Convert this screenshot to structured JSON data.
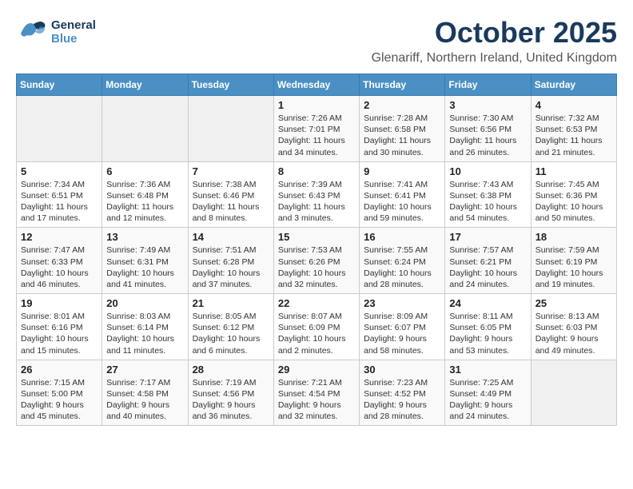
{
  "header": {
    "logo_general": "General",
    "logo_blue": "Blue",
    "month_title": "October 2025",
    "location": "Glenariff, Northern Ireland, United Kingdom"
  },
  "weekdays": [
    "Sunday",
    "Monday",
    "Tuesday",
    "Wednesday",
    "Thursday",
    "Friday",
    "Saturday"
  ],
  "weeks": [
    [
      {
        "day": "",
        "content": ""
      },
      {
        "day": "",
        "content": ""
      },
      {
        "day": "",
        "content": ""
      },
      {
        "day": "1",
        "content": "Sunrise: 7:26 AM\nSunset: 7:01 PM\nDaylight: 11 hours\nand 34 minutes."
      },
      {
        "day": "2",
        "content": "Sunrise: 7:28 AM\nSunset: 6:58 PM\nDaylight: 11 hours\nand 30 minutes."
      },
      {
        "day": "3",
        "content": "Sunrise: 7:30 AM\nSunset: 6:56 PM\nDaylight: 11 hours\nand 26 minutes."
      },
      {
        "day": "4",
        "content": "Sunrise: 7:32 AM\nSunset: 6:53 PM\nDaylight: 11 hours\nand 21 minutes."
      }
    ],
    [
      {
        "day": "5",
        "content": "Sunrise: 7:34 AM\nSunset: 6:51 PM\nDaylight: 11 hours\nand 17 minutes."
      },
      {
        "day": "6",
        "content": "Sunrise: 7:36 AM\nSunset: 6:48 PM\nDaylight: 11 hours\nand 12 minutes."
      },
      {
        "day": "7",
        "content": "Sunrise: 7:38 AM\nSunset: 6:46 PM\nDaylight: 11 hours\nand 8 minutes."
      },
      {
        "day": "8",
        "content": "Sunrise: 7:39 AM\nSunset: 6:43 PM\nDaylight: 11 hours\nand 3 minutes."
      },
      {
        "day": "9",
        "content": "Sunrise: 7:41 AM\nSunset: 6:41 PM\nDaylight: 10 hours\nand 59 minutes."
      },
      {
        "day": "10",
        "content": "Sunrise: 7:43 AM\nSunset: 6:38 PM\nDaylight: 10 hours\nand 54 minutes."
      },
      {
        "day": "11",
        "content": "Sunrise: 7:45 AM\nSunset: 6:36 PM\nDaylight: 10 hours\nand 50 minutes."
      }
    ],
    [
      {
        "day": "12",
        "content": "Sunrise: 7:47 AM\nSunset: 6:33 PM\nDaylight: 10 hours\nand 46 minutes."
      },
      {
        "day": "13",
        "content": "Sunrise: 7:49 AM\nSunset: 6:31 PM\nDaylight: 10 hours\nand 41 minutes."
      },
      {
        "day": "14",
        "content": "Sunrise: 7:51 AM\nSunset: 6:28 PM\nDaylight: 10 hours\nand 37 minutes."
      },
      {
        "day": "15",
        "content": "Sunrise: 7:53 AM\nSunset: 6:26 PM\nDaylight: 10 hours\nand 32 minutes."
      },
      {
        "day": "16",
        "content": "Sunrise: 7:55 AM\nSunset: 6:24 PM\nDaylight: 10 hours\nand 28 minutes."
      },
      {
        "day": "17",
        "content": "Sunrise: 7:57 AM\nSunset: 6:21 PM\nDaylight: 10 hours\nand 24 minutes."
      },
      {
        "day": "18",
        "content": "Sunrise: 7:59 AM\nSunset: 6:19 PM\nDaylight: 10 hours\nand 19 minutes."
      }
    ],
    [
      {
        "day": "19",
        "content": "Sunrise: 8:01 AM\nSunset: 6:16 PM\nDaylight: 10 hours\nand 15 minutes."
      },
      {
        "day": "20",
        "content": "Sunrise: 8:03 AM\nSunset: 6:14 PM\nDaylight: 10 hours\nand 11 minutes."
      },
      {
        "day": "21",
        "content": "Sunrise: 8:05 AM\nSunset: 6:12 PM\nDaylight: 10 hours\nand 6 minutes."
      },
      {
        "day": "22",
        "content": "Sunrise: 8:07 AM\nSunset: 6:09 PM\nDaylight: 10 hours\nand 2 minutes."
      },
      {
        "day": "23",
        "content": "Sunrise: 8:09 AM\nSunset: 6:07 PM\nDaylight: 9 hours\nand 58 minutes."
      },
      {
        "day": "24",
        "content": "Sunrise: 8:11 AM\nSunset: 6:05 PM\nDaylight: 9 hours\nand 53 minutes."
      },
      {
        "day": "25",
        "content": "Sunrise: 8:13 AM\nSunset: 6:03 PM\nDaylight: 9 hours\nand 49 minutes."
      }
    ],
    [
      {
        "day": "26",
        "content": "Sunrise: 7:15 AM\nSunset: 5:00 PM\nDaylight: 9 hours\nand 45 minutes."
      },
      {
        "day": "27",
        "content": "Sunrise: 7:17 AM\nSunset: 4:58 PM\nDaylight: 9 hours\nand 40 minutes."
      },
      {
        "day": "28",
        "content": "Sunrise: 7:19 AM\nSunset: 4:56 PM\nDaylight: 9 hours\nand 36 minutes."
      },
      {
        "day": "29",
        "content": "Sunrise: 7:21 AM\nSunset: 4:54 PM\nDaylight: 9 hours\nand 32 minutes."
      },
      {
        "day": "30",
        "content": "Sunrise: 7:23 AM\nSunset: 4:52 PM\nDaylight: 9 hours\nand 28 minutes."
      },
      {
        "day": "31",
        "content": "Sunrise: 7:25 AM\nSunset: 4:49 PM\nDaylight: 9 hours\nand 24 minutes."
      },
      {
        "day": "",
        "content": ""
      }
    ]
  ]
}
